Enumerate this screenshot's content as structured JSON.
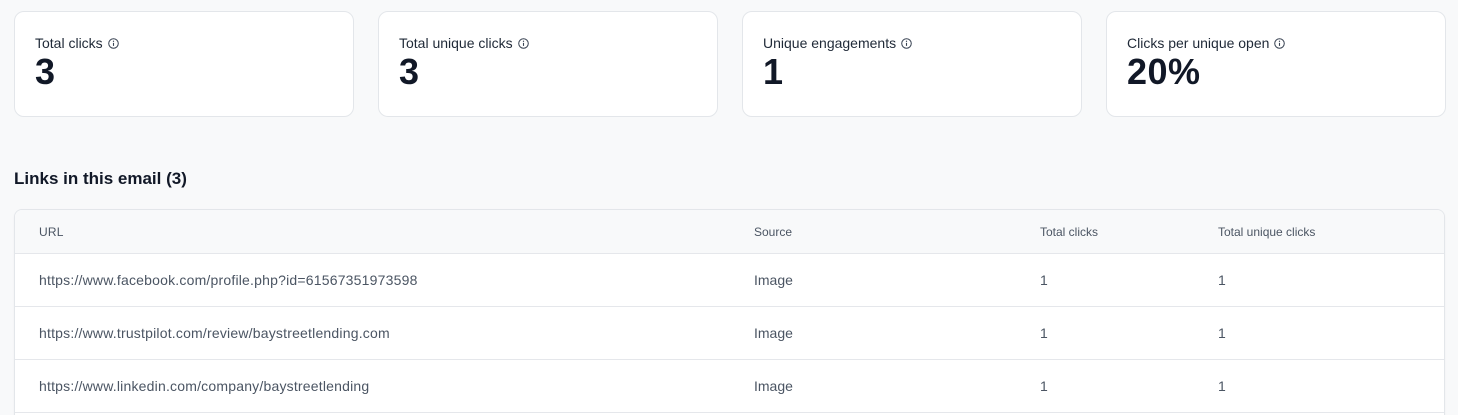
{
  "stats": [
    {
      "label": "Total clicks",
      "value": "3"
    },
    {
      "label": "Total unique clicks",
      "value": "3"
    },
    {
      "label": "Unique engagements",
      "value": "1"
    },
    {
      "label": "Clicks per unique open",
      "value": "20%"
    }
  ],
  "links": {
    "title": "Links in this email (3)",
    "columns": [
      "URL",
      "Source",
      "Total clicks",
      "Total unique clicks"
    ],
    "rows": [
      {
        "url": "https://www.facebook.com/profile.php?id=61567351973598",
        "source": "Image",
        "total_clicks": "1",
        "unique_clicks": "1"
      },
      {
        "url": "https://www.trustpilot.com/review/baystreetlending.com",
        "source": "Image",
        "total_clicks": "1",
        "unique_clicks": "1"
      },
      {
        "url": "https://www.linkedin.com/company/baystreetlending",
        "source": "Image",
        "total_clicks": "1",
        "unique_clicks": "1"
      }
    ]
  }
}
